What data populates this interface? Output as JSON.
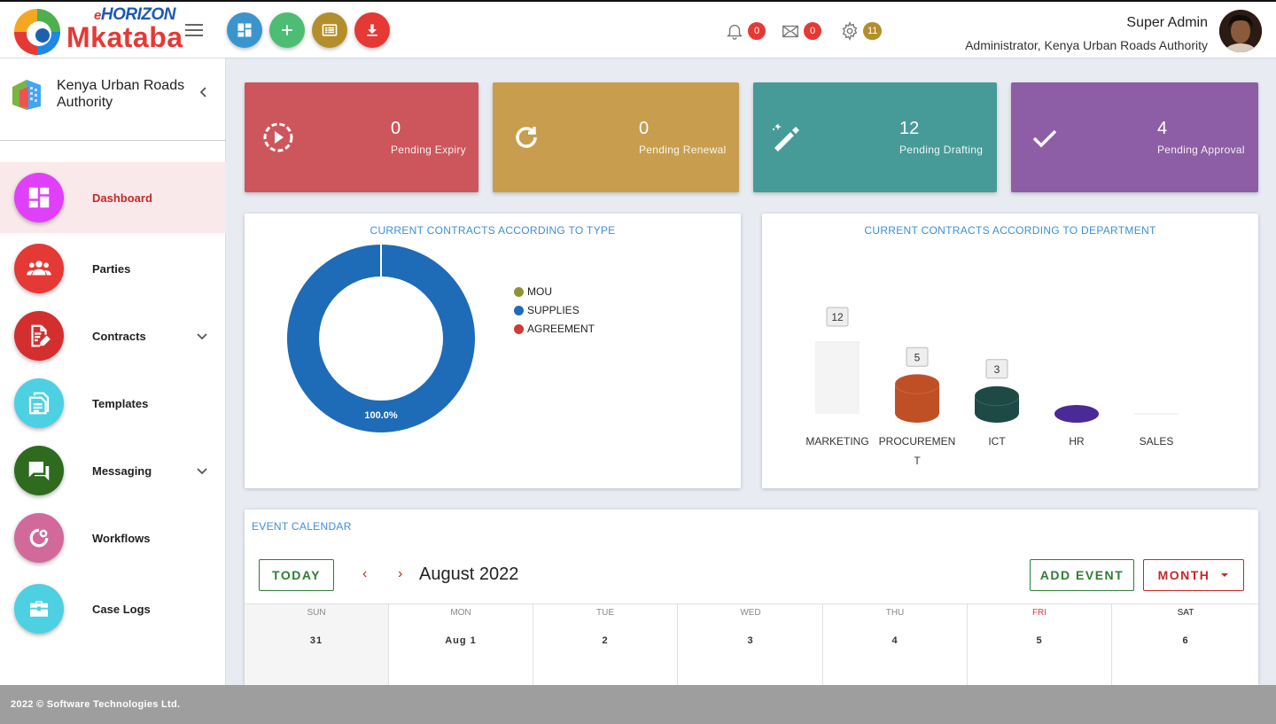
{
  "brand": {
    "prefix": "e",
    "name_top": "HORIZON",
    "name_main": "Mkataba"
  },
  "quick_actions": [
    {
      "icon": "dashboard-icon",
      "color": "#3a95cf"
    },
    {
      "icon": "plus-icon",
      "color": "#4dbd74"
    },
    {
      "icon": "list-icon",
      "color": "#b38f2c"
    },
    {
      "icon": "download-icon",
      "color": "#e53935"
    }
  ],
  "notifications": {
    "bell_count": "0",
    "mail_count": "0",
    "settings_count": "11"
  },
  "user": {
    "name": "Super Admin",
    "role": "Administrator, Kenya Urban Roads Authority"
  },
  "organization": {
    "name": "Kenya Urban Roads Authority"
  },
  "nav": [
    {
      "label": "Dashboard",
      "color": "#e040fb",
      "icon": "dashboard-icon",
      "active": true
    },
    {
      "label": "Parties",
      "color": "#e53935",
      "icon": "people-icon"
    },
    {
      "label": "Contracts",
      "color": "#d32f2f",
      "icon": "contract-icon",
      "expandable": true
    },
    {
      "label": "Templates",
      "color": "#4dd0e1",
      "icon": "template-icon"
    },
    {
      "label": "Messaging",
      "color": "#2e6b1f",
      "icon": "chat-icon",
      "expandable": true
    },
    {
      "label": "Workflows",
      "color": "#d16a9a",
      "icon": "workflow-icon"
    },
    {
      "label": "Case Logs",
      "color": "#4dd0e1",
      "icon": "briefcase-icon"
    }
  ],
  "stats": [
    {
      "value": "0",
      "label": "Pending Expiry",
      "color": "#cd565c",
      "icon": "play-circle-icon"
    },
    {
      "value": "0",
      "label": "Pending Renewal",
      "color": "#c89e4e",
      "icon": "refresh-icon"
    },
    {
      "value": "12",
      "label": "Pending Drafting",
      "color": "#469b98",
      "icon": "magic-wand-icon"
    },
    {
      "value": "4",
      "label": "Pending Approval",
      "color": "#8d5da5",
      "icon": "check-icon"
    }
  ],
  "chart_data": [
    {
      "type": "pie",
      "title": "CURRENT CONTRACTS ACCORDING TO TYPE",
      "series": [
        {
          "name": "MOU",
          "value": 0,
          "color": "#8f9335"
        },
        {
          "name": "SUPPLIES",
          "value": 100.0,
          "color": "#1e6bb8"
        },
        {
          "name": "AGREEMENT",
          "value": 0,
          "color": "#d23a32"
        }
      ],
      "data_label": "100.0%",
      "legend": "right"
    },
    {
      "type": "bar",
      "title": "CURRENT CONTRACTS ACCORDING TO DEPARTMENT",
      "categories": [
        "MARKETING",
        "PROCUREMENT",
        "ICT",
        "HR",
        "SALES"
      ],
      "category_display": [
        "MARKETING",
        "PROCUREMEN",
        "ICT",
        "HR",
        "SALES"
      ],
      "category_display_wrap": [
        "",
        "T",
        "",
        "",
        ""
      ],
      "values": [
        12,
        5,
        3,
        1,
        0
      ],
      "data_labels": [
        "12",
        "5",
        "3",
        "",
        ""
      ],
      "colors": [
        "#f4f4f4",
        "#bf4f24",
        "#1d4a44",
        "#4a2a96",
        "#f4f4f4"
      ]
    }
  ],
  "calendar": {
    "title": "EVENT CALENDAR",
    "today_label": "TODAY",
    "prev": "‹",
    "next": "›",
    "month": "August 2022",
    "add_event_label": "ADD EVENT",
    "view_label": "MONTH",
    "days": [
      {
        "name": "SUN",
        "date": "31"
      },
      {
        "name": "MON",
        "date": "Aug 1"
      },
      {
        "name": "TUE",
        "date": "2"
      },
      {
        "name": "WED",
        "date": "3"
      },
      {
        "name": "THU",
        "date": "4"
      },
      {
        "name": "FRI",
        "date": "5"
      },
      {
        "name": "SAT",
        "date": "6"
      }
    ]
  },
  "footer": {
    "text": "2022 © Software Technologies Ltd."
  }
}
